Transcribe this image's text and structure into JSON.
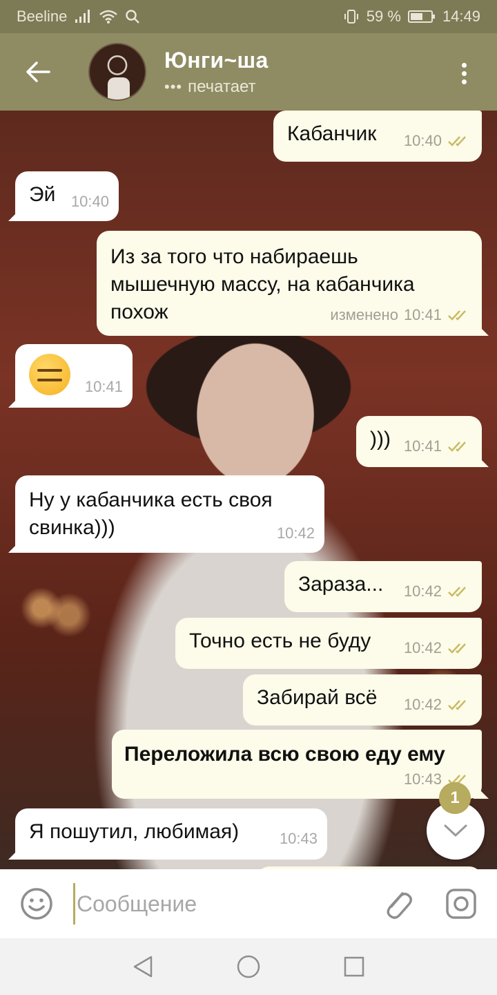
{
  "status_bar": {
    "carrier": "Beeline",
    "battery": "59 %",
    "time": "14:49"
  },
  "header": {
    "contact_name": "Юнги~ша",
    "status": "печатает"
  },
  "messages": [
    {
      "direction": "out",
      "text": "Кабанчик",
      "time": "10:40",
      "read": true
    },
    {
      "direction": "in",
      "text": "Эй",
      "time": "10:40"
    },
    {
      "direction": "out",
      "text": "Из за того что набираешь мышечную массу, на кабанчика похож",
      "time": "10:41",
      "edited_label": "изменено",
      "read": true
    },
    {
      "direction": "in",
      "emoji": "expressionless-face",
      "time": "10:41"
    },
    {
      "direction": "out",
      "text": ")))",
      "time": "10:41",
      "read": true
    },
    {
      "direction": "in",
      "text": "Ну у кабанчика есть своя свинка)))",
      "time": "10:42"
    },
    {
      "direction": "out",
      "text": "Зараза...",
      "time": "10:42",
      "read": true
    },
    {
      "direction": "out",
      "text": "Точно есть не буду",
      "time": "10:42",
      "read": true
    },
    {
      "direction": "out",
      "text": "Забирай всё",
      "time": "10:42",
      "read": true
    },
    {
      "direction": "out",
      "text": "Переложила всю свою еду ему",
      "time": "10:43",
      "read": true,
      "bold": true
    },
    {
      "direction": "in",
      "text": "Я пошутил, любимая)",
      "time": "10:43"
    }
  ],
  "scroll_badge": "1",
  "input": {
    "placeholder": "Сообщение"
  },
  "colors": {
    "header": "#8f8c64",
    "status_bar": "#7d7a56",
    "outgoing_bubble": "#fdfbe9",
    "incoming_bubble": "#ffffff",
    "accent": "#b6ab5e",
    "read_checks": "#c7bb64"
  }
}
